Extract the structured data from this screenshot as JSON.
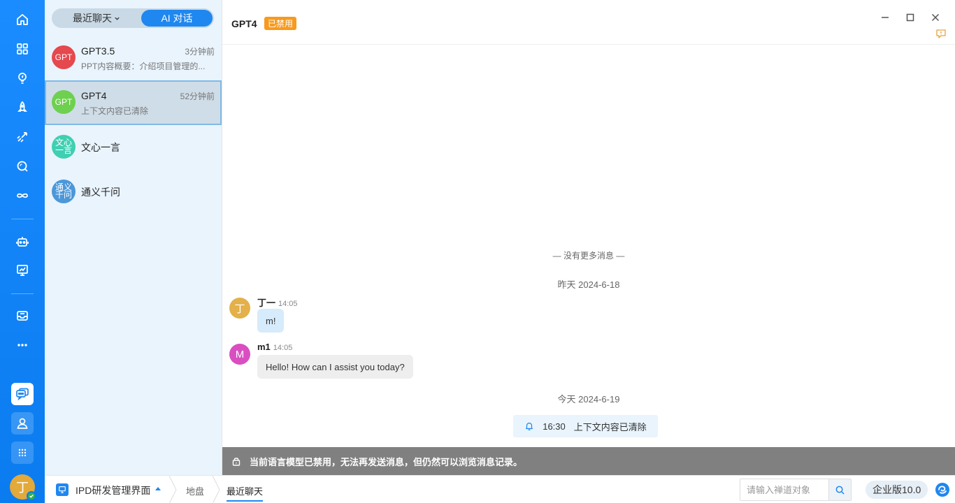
{
  "rail": {
    "icons": [
      "home-icon",
      "apps-icon",
      "lightbulb-icon",
      "rocket-icon",
      "launch-icon",
      "search-icon",
      "infinity-icon",
      "robot-icon",
      "presentation-icon",
      "inbox-icon",
      "more-icon",
      "chat-icon",
      "contacts-icon",
      "grid-icon"
    ],
    "avatar_initial": "丁"
  },
  "list": {
    "tab_recent": "最近聊天",
    "tab_ai": "AI 对话",
    "conversations": [
      {
        "avatar": "GPT",
        "name": "GPT3.5",
        "time": "3分钟前",
        "preview": "PPT内容概要：介绍项目管理的...",
        "color": "#e5484d"
      },
      {
        "avatar": "GPT",
        "name": "GPT4",
        "time": "52分钟前",
        "preview": "上下文内容已清除",
        "color": "#6ed04f"
      },
      {
        "avatar_line1": "文心",
        "avatar_line2": "一言",
        "name": "文心一言",
        "color": "#3fcfb2"
      },
      {
        "avatar_line1": "通义",
        "avatar_line2": "千问",
        "name": "通义千问",
        "color": "#4c97d9"
      }
    ]
  },
  "chat": {
    "title": "GPT4",
    "status_badge": "已禁用",
    "no_more": "— 没有更多消息 —",
    "date_yesterday": "昨天 2024-6-18",
    "date_today": "今天 2024-6-19",
    "messages": [
      {
        "avatar": "丁",
        "sender": "丁一",
        "time": "14:05",
        "text": "m!",
        "avatar_color": "#e3b04a",
        "bubble_color": "#d6ebfb"
      },
      {
        "avatar": "M",
        "sender": "m1",
        "time": "14:05",
        "text": "Hello! How can I assist you today?",
        "avatar_color": "#d94fc1",
        "bubble_color": "#eeeeee"
      }
    ],
    "notice_time": "16:30",
    "notice_text": "上下文内容已清除",
    "disabled_message": "当前语言模型已禁用，无法再发送消息，但仍然可以浏览消息记录。"
  },
  "statusbar": {
    "project": "IPD研发管理界面",
    "crumb_1": "地盘",
    "crumb_2": "最近聊天",
    "search_placeholder": "请输入禅道对象",
    "edition": "企业版10.0"
  },
  "colors": {
    "accent": "#1f87f0",
    "badge": "#f79a1e",
    "disabled_bar": "#808080"
  }
}
